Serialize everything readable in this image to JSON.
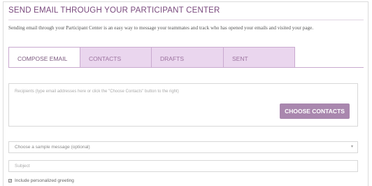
{
  "header": {
    "title": "SEND EMAIL THROUGH YOUR PARTICIPANT CENTER",
    "intro": "Sending email through your Participant Center is an easy way to message your teammates and track who has opened your emails and visited your page."
  },
  "tabs": [
    {
      "label": "COMPOSE EMAIL",
      "active": true
    },
    {
      "label": "CONTACTS",
      "active": false
    },
    {
      "label": "DRAFTS",
      "active": false
    },
    {
      "label": "SENT",
      "active": false
    }
  ],
  "compose": {
    "recipients_placeholder": "Recipients (type email addresses here or click the \"Choose Contacts\" button to the right)",
    "choose_contacts_label": "CHOOSE CONTACTS",
    "sample_message_value": "Choose a sample message (optional)",
    "subject_placeholder": "Subject",
    "personalized_greeting_label": "Include personalized greeting",
    "personalized_greeting_checked": true
  },
  "colors": {
    "accent": "#a987ae",
    "title": "#7a4a7e",
    "tab_bg": "#ead6ee",
    "tab_border": "#c9a9cf"
  }
}
